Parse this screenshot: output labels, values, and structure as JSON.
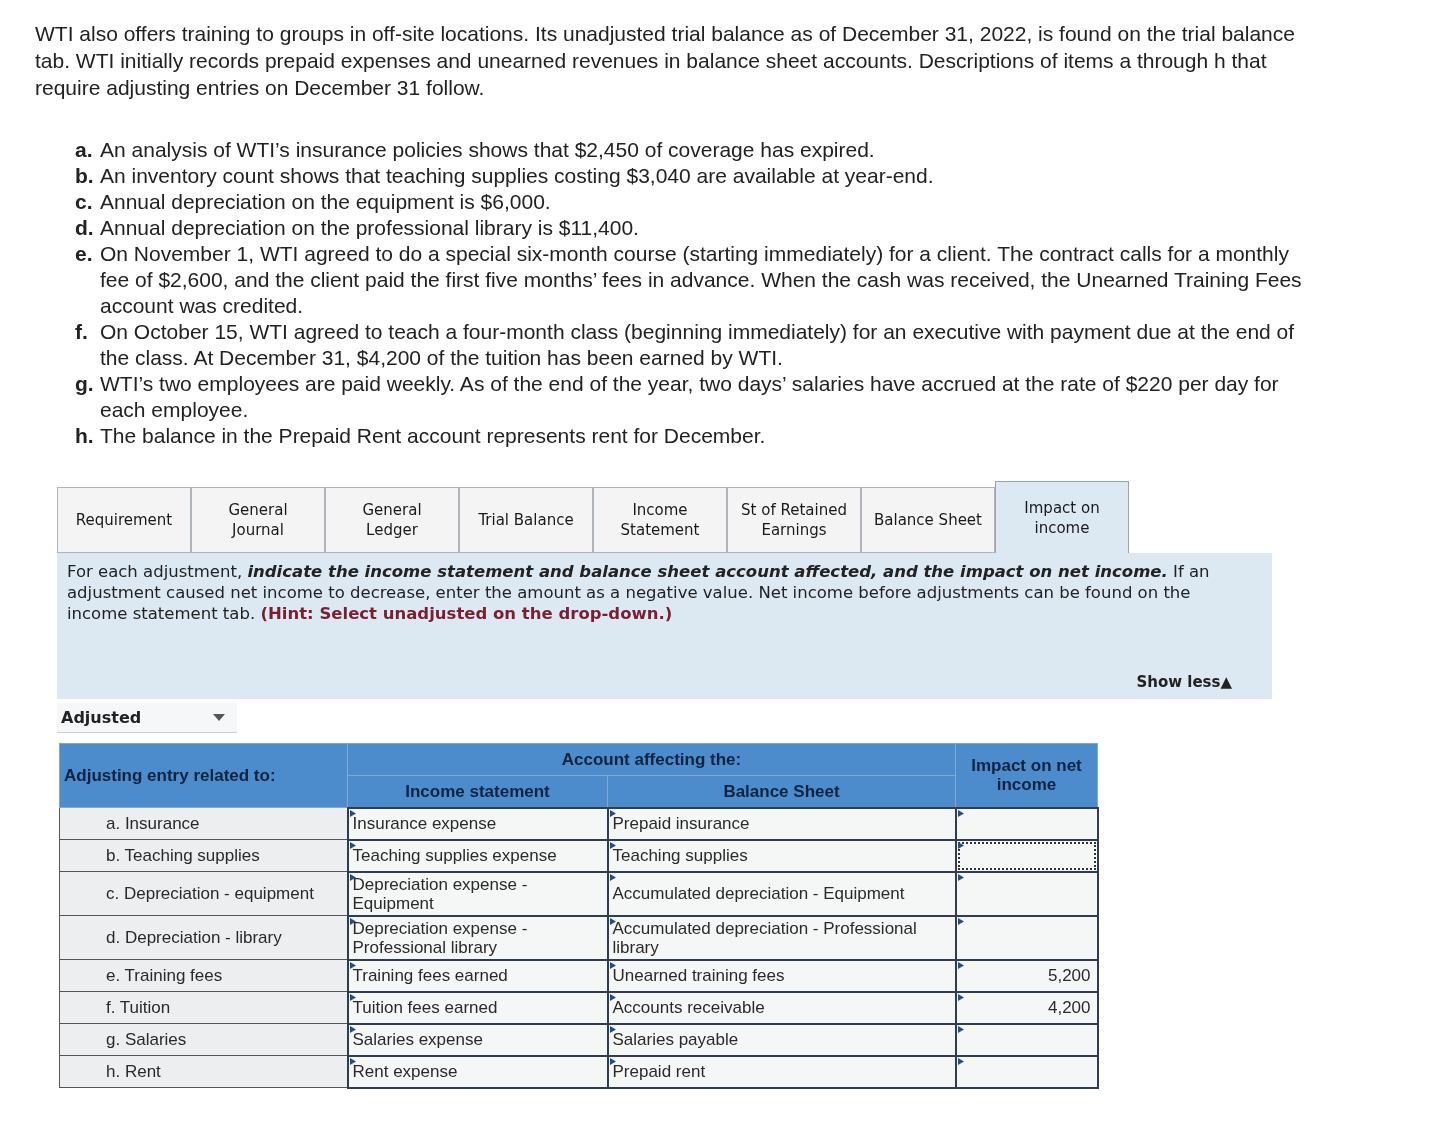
{
  "problem": {
    "intro": "WTI also offers training to groups in off-site locations. Its unadjusted trial balance as of December 31, 2022, is found on the trial balance tab. WTI initially records prepaid expenses and unearned revenues in balance sheet accounts. Descriptions of items a through h that require adjusting entries on December 31 follow.",
    "items": [
      {
        "letter": "a.",
        "text": "An analysis of WTI’s insurance policies shows that $2,450 of coverage has expired."
      },
      {
        "letter": "b.",
        "text": "An inventory count shows that teaching supplies costing $3,040 are available at year-end."
      },
      {
        "letter": "c.",
        "text": "Annual depreciation on the equipment is $6,000."
      },
      {
        "letter": "d.",
        "text": "Annual depreciation on the professional library is $11,400."
      },
      {
        "letter": "e.",
        "text": "On November 1, WTI agreed to do a special six-month course (starting immediately) for a client. The contract calls for a monthly fee of $2,600, and the client paid the first five months’ fees in advance. When the cash was received, the Unearned Training Fees account was credited."
      },
      {
        "letter": "f.",
        "text": "On October 15, WTI agreed to teach a four-month class (beginning immediately) for an executive with payment due at the end of the class. At December 31, $4,200 of the tuition has been earned by WTI."
      },
      {
        "letter": "g.",
        "text": "WTI’s two employees are paid weekly. As of the end of the year, two days’ salaries have accrued at the rate of $220 per day for each employee."
      },
      {
        "letter": "h.",
        "text": "The balance in the Prepaid Rent account represents rent for December."
      }
    ]
  },
  "tabs": [
    {
      "label": "Requirement",
      "selected": false
    },
    {
      "label": "General Journal",
      "selected": false
    },
    {
      "label": "General Ledger",
      "selected": false
    },
    {
      "label": "Trial Balance",
      "selected": false
    },
    {
      "label": "Income Statement",
      "selected": false
    },
    {
      "label": "St of Retained Earnings",
      "selected": false
    },
    {
      "label": "Balance Sheet",
      "selected": false
    },
    {
      "label": "Impact on income",
      "selected": true
    }
  ],
  "instructions": {
    "segments": [
      {
        "kind": "plain",
        "text": "For each adjustment, "
      },
      {
        "kind": "emphasis",
        "text": "indicate the income statement and balance sheet account affected, and the impact on net income."
      },
      {
        "kind": "plain",
        "text": " If an adjustment caused net income to decrease, enter the amount as a negative value. Net income before adjustments can be found on the income statement tab. "
      },
      {
        "kind": "hint",
        "text": "(Hint: Select unadjusted on the drop-down.)"
      }
    ],
    "toggle": "Show less▲"
  },
  "view_select": {
    "value": "Adjusted"
  },
  "table": {
    "header_entry": "Adjusting entry related to:",
    "header_group": "Account affecting the:",
    "header_income": "Income statement",
    "header_balance": "Balance Sheet",
    "header_impact": "Impact on net income",
    "rows": [
      {
        "entry": "a. Insurance",
        "income_account": "Insurance expense",
        "balance_account": "Prepaid insurance",
        "focused": false
      },
      {
        "entry": "b. Teaching supplies",
        "income_account": "Teaching supplies expense",
        "balance_account": "Teaching supplies",
        "focused": true
      },
      {
        "entry": "c. Depreciation - equipment",
        "income_account": "Depreciation expense - Equipment",
        "balance_account": "Accumulated depreciation - Equipment",
        "focused": false
      },
      {
        "entry": "d. Depreciation - library",
        "income_account": "Depreciation expense - Professional library",
        "balance_account": "Accumulated depreciation - Professional library",
        "focused": false
      },
      {
        "entry": "e. Training fees",
        "income_account": "Training fees earned",
        "balance_account": "Unearned training fees",
        "impact": "5,200",
        "focused": false
      },
      {
        "entry": "f. Tuition",
        "income_account": "Tuition fees earned",
        "balance_account": "Accounts receivable",
        "impact": "4,200",
        "focused": false
      },
      {
        "entry": "g. Salaries",
        "income_account": "Salaries expense",
        "balance_account": "Salaries payable",
        "focused": false
      },
      {
        "entry": "h. Rent",
        "income_account": "Rent expense",
        "balance_account": "Prepaid rent",
        "focused": false
      }
    ]
  }
}
